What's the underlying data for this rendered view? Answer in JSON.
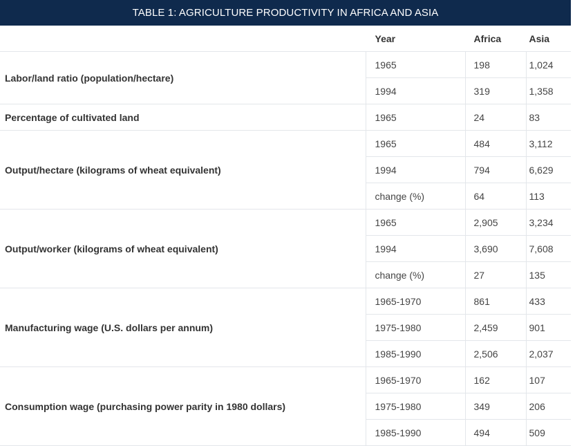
{
  "table": {
    "title": "TABLE 1: AGRICULTURE PRODUCTIVITY IN AFRICA AND ASIA",
    "headers": {
      "label": "",
      "year": "Year",
      "africa": "Africa",
      "asia": "Asia"
    },
    "groups": [
      {
        "label": "Labor/land ratio (population/hectare)",
        "rows": [
          {
            "year": "1965",
            "africa": "198",
            "asia": "1,024"
          },
          {
            "year": "1994",
            "africa": "319",
            "asia": "1,358"
          }
        ]
      },
      {
        "label": "Percentage of cultivated land",
        "rows": [
          {
            "year": "1965",
            "africa": "24",
            "asia": "83"
          }
        ]
      },
      {
        "label": "Output/hectare (kilograms of wheat equivalent)",
        "rows": [
          {
            "year": "1965",
            "africa": "484",
            "asia": "3,112"
          },
          {
            "year": "1994",
            "africa": "794",
            "asia": "6,629"
          },
          {
            "year": "change (%)",
            "africa": "64",
            "asia": "113"
          }
        ]
      },
      {
        "label": "Output/worker (kilograms of wheat equivalent)",
        "rows": [
          {
            "year": "1965",
            "africa": "2,905",
            "asia": "3,234"
          },
          {
            "year": "1994",
            "africa": "3,690",
            "asia": "7,608"
          },
          {
            "year": "change (%)",
            "africa": "27",
            "asia": "135"
          }
        ]
      },
      {
        "label": "Manufacturing wage (U.S. dollars per annum)",
        "rows": [
          {
            "year": "1965-1970",
            "africa": "861",
            "asia": "433"
          },
          {
            "year": "1975-1980",
            "africa": "2,459",
            "asia": "901"
          },
          {
            "year": "1985-1990",
            "africa": "2,506",
            "asia": "2,037"
          }
        ]
      },
      {
        "label": "Consumption wage (purchasing power parity in 1980 dollars)",
        "rows": [
          {
            "year": "1965-1970",
            "africa": "162",
            "asia": "107"
          },
          {
            "year": "1975-1980",
            "africa": "349",
            "asia": "206"
          },
          {
            "year": "1985-1990",
            "africa": "494",
            "asia": "509"
          }
        ]
      }
    ]
  }
}
